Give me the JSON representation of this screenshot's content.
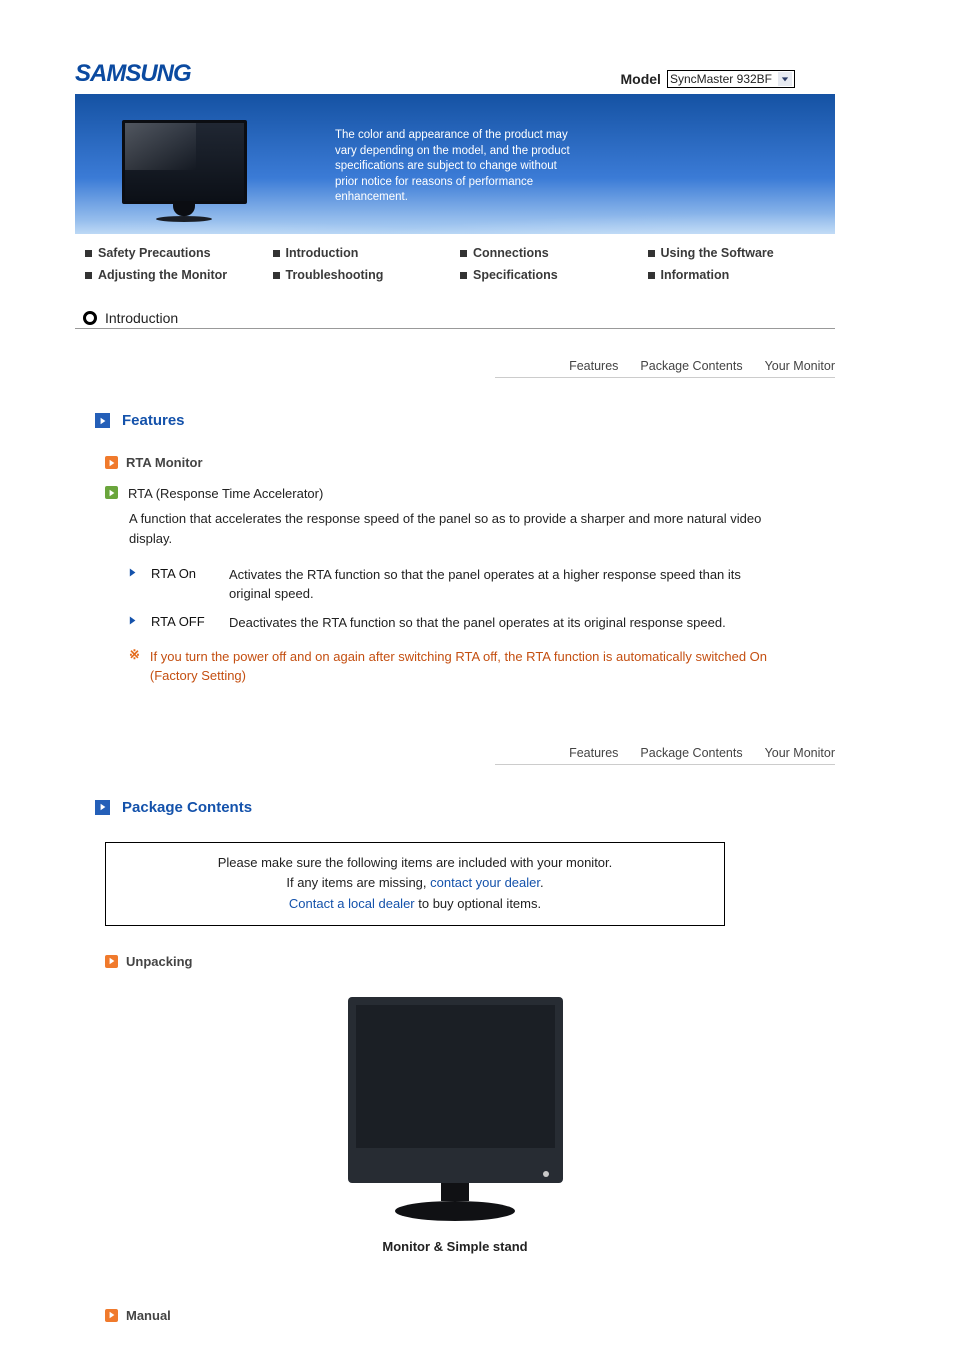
{
  "brand": "SAMSUNG",
  "model": {
    "label": "Model",
    "value": "SyncMaster 932BF"
  },
  "banner": {
    "disclaimer": "The color and appearance of the product may vary depending on the model, and the product specifications are subject to change without prior notice for reasons of performance enhancement."
  },
  "nav": {
    "row1": [
      "Safety Precautions",
      "Introduction",
      "Connections",
      "Using the Software"
    ],
    "row2": [
      "Adjusting the Monitor",
      "Troubleshooting",
      "Specifications",
      "Information"
    ]
  },
  "section_chip": "Introduction",
  "subtabs": [
    "Features",
    "Package Contents",
    "Your Monitor"
  ],
  "features": {
    "heading": "Features",
    "rta_heading": "RTA Monitor",
    "rta_item": "RTA (Response Time Accelerator)",
    "rta_desc": "A function that accelerates the response speed of the panel so as to provide a sharper and more natural video display.",
    "opts": [
      {
        "name": "RTA On",
        "desc": "Activates the RTA function so that the panel operates at a higher response speed than its original speed."
      },
      {
        "name": "RTA OFF",
        "desc": "Deactivates the RTA function so that the panel operates at its original response speed."
      }
    ],
    "note": "If you turn the power off and on again after switching RTA off, the RTA function is automatically switched On (Factory Setting)"
  },
  "package": {
    "heading": "Package Contents",
    "callout": {
      "line1": "Please make sure the following items are included with your monitor.",
      "line2_pre": "If any items are missing, ",
      "line2_link": "contact your dealer",
      "line2_post": ".",
      "line3_link": "Contact a local dealer",
      "line3_post": " to buy optional items."
    },
    "unpacking_heading": "Unpacking",
    "product_caption": "Monitor & Simple stand",
    "manual_heading": "Manual"
  }
}
